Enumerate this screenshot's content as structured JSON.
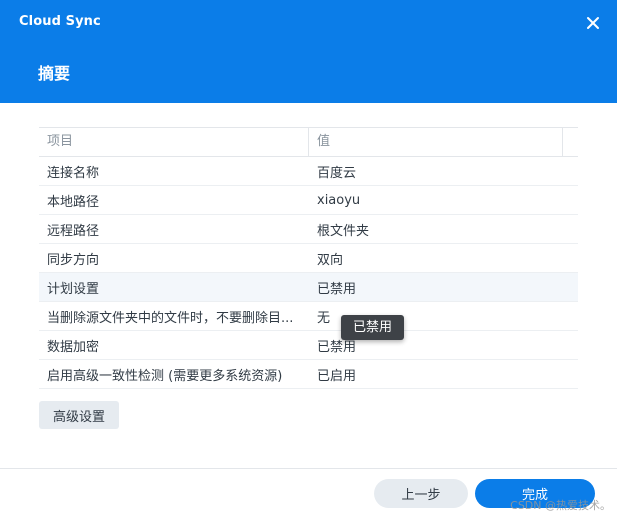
{
  "window": {
    "app_title": "Cloud Sync",
    "page_title": "摘要",
    "close_icon": "close-icon"
  },
  "colors": {
    "header_bg": "#0b7de8",
    "primary": "#0b7de8",
    "secondary_btn": "#e6ebf0",
    "tooltip_bg": "#3e4247"
  },
  "table": {
    "headers": [
      "项目",
      "值"
    ],
    "rows": [
      {
        "item": "连接名称",
        "value": "百度云"
      },
      {
        "item": "本地路径",
        "value": "xiaoyu"
      },
      {
        "item": "远程路径",
        "value": "根文件夹"
      },
      {
        "item": "同步方向",
        "value": "双向"
      },
      {
        "item": "计划设置",
        "value": "已禁用"
      },
      {
        "item": "当删除源文件夹中的文件时，不要删除目...",
        "value": "无"
      },
      {
        "item": "数据加密",
        "value": "已禁用"
      },
      {
        "item": "启用高级一致性检测 (需要更多系统资源)",
        "value": "已启用"
      }
    ]
  },
  "tooltip": {
    "text": "已禁用"
  },
  "buttons": {
    "advanced": "高级设置",
    "prev": "上一步",
    "done": "完成"
  },
  "watermark": "CSDN @热爱技术。"
}
